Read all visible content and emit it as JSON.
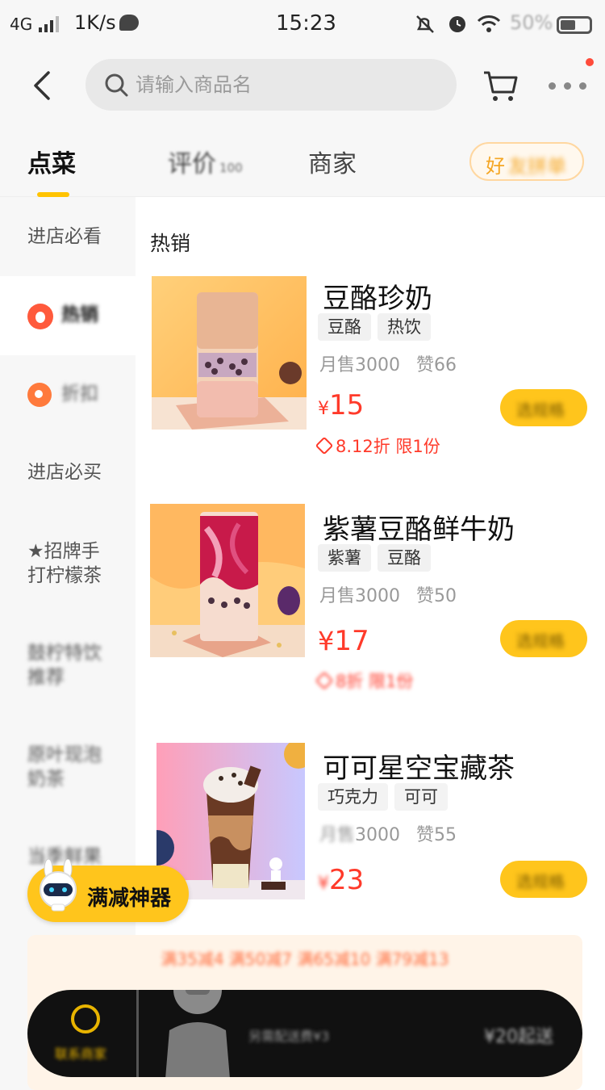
{
  "status_bar": {
    "network": "4G",
    "speed": "1K/s",
    "time": "15:23",
    "battery": "50%"
  },
  "header": {
    "search_placeholder": "请输入商品名",
    "icons": [
      "back-icon",
      "search-icon",
      "cart-icon",
      "more-icon"
    ]
  },
  "tabs": {
    "order": "点菜",
    "reviews": "评价",
    "reviews_count": "100",
    "merchant": "商家",
    "group_prefix": "好",
    "group_rest": "友拼单"
  },
  "sidebar": {
    "items": [
      {
        "label": "进店必看"
      },
      {
        "label": "热销"
      },
      {
        "label": "折扣"
      },
      {
        "label": "进店必买"
      },
      {
        "label": "★招牌手\n打柠檬茶"
      },
      {
        "label": "鼓柠特饮\n推荐"
      },
      {
        "label": "原叶现泡\n奶茶"
      },
      {
        "label": "当季鲜果"
      }
    ]
  },
  "main": {
    "section_title": "热销",
    "products": [
      {
        "name": "豆酪珍奶",
        "tags": [
          "豆酪",
          "热饮"
        ],
        "monthly_sales_label": "月售",
        "monthly_sales": "3000",
        "likes_label": "赞",
        "likes": "66",
        "currency": "¥",
        "price": "15",
        "promo": "8.12折 限1份",
        "spec_button": "选规格"
      },
      {
        "name": "紫薯豆酪鲜牛奶",
        "tags": [
          "紫薯",
          "豆酪"
        ],
        "monthly_sales_label": "月售",
        "monthly_sales": "3000",
        "likes_label": "赞",
        "likes": "50",
        "currency": "¥",
        "price": "17",
        "promo": "8折 限1份",
        "spec_button": "选规格"
      },
      {
        "name": "可可星空宝藏茶",
        "tags": [
          "巧克力",
          "可可"
        ],
        "monthly_sales_label": "月售",
        "monthly_sales": "3000",
        "likes_label": "赞",
        "likes": "55",
        "currency": "¥",
        "price": "23",
        "spec_button": "选规格"
      }
    ]
  },
  "floating_badge": {
    "label": "满减神器"
  },
  "promo_banner": {
    "text": "满35减4 满50减7 满65减10 满79减13"
  },
  "bottom_bar": {
    "contact_label": "联系商家",
    "delivery_fee": "另需配送费¥3",
    "min_order": "¥20起送"
  },
  "colors": {
    "accent": "#ffc51c",
    "price": "#ff3a2a",
    "sidebar_bg": "#f7f7f7",
    "bottom_bar": "#111111"
  }
}
